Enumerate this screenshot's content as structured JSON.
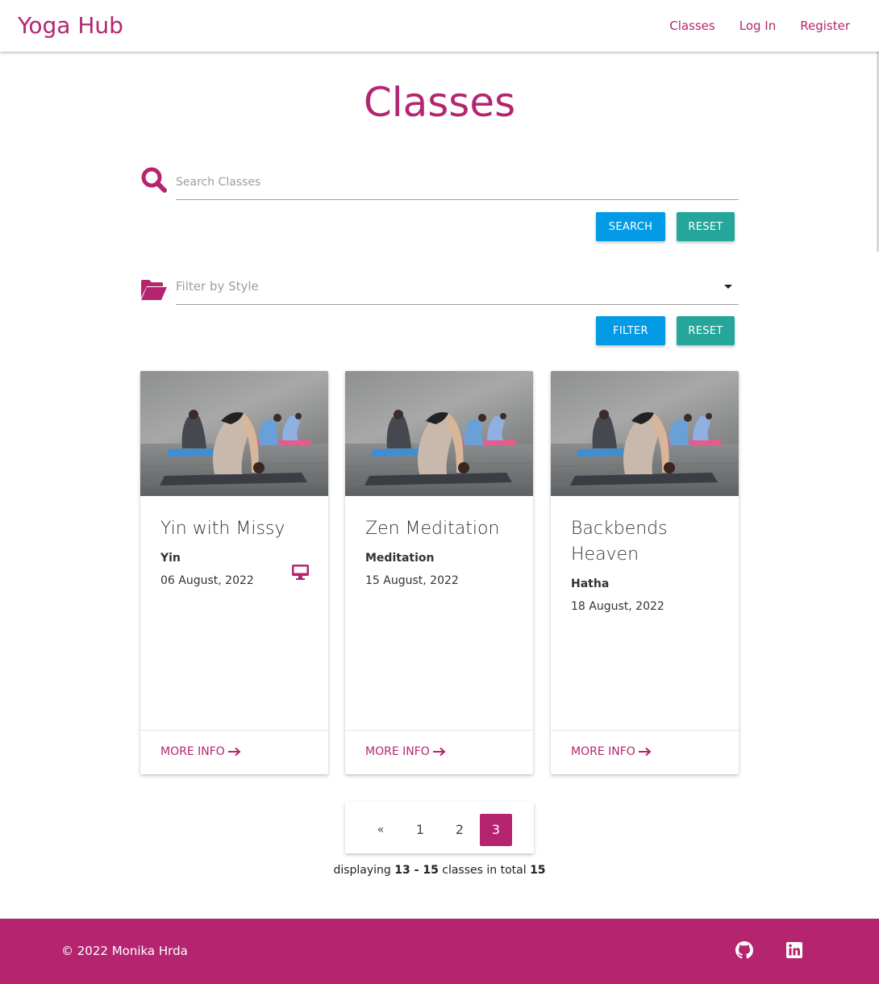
{
  "nav": {
    "brand": "Yoga Hub",
    "links": [
      "Classes",
      "Log In",
      "Register"
    ]
  },
  "page": {
    "title": "Classes"
  },
  "search": {
    "placeholder": "Search Classes",
    "search_label": "SEARCH",
    "reset_label": "RESET",
    "icon": "search-icon"
  },
  "filter": {
    "placeholder": "Filter by Style",
    "filter_label": "FILTER",
    "reset_label": "RESET",
    "icon": "folder-open-icon"
  },
  "classes": [
    {
      "title": "Yin with Missy",
      "style": "Yin",
      "date": "06 August, 2022",
      "online": true,
      "action": "MORE INFO"
    },
    {
      "title": "Zen Meditation",
      "style": "Meditation",
      "date": "15 August, 2022",
      "online": false,
      "action": "MORE INFO"
    },
    {
      "title": "Backbends Heaven",
      "style": "Hatha",
      "date": "18 August, 2022",
      "online": false,
      "action": "MORE INFO"
    }
  ],
  "pagination": {
    "prev": "«",
    "pages": [
      "1",
      "2",
      "3"
    ],
    "active_page": "3",
    "summary": {
      "prefix": "displaying",
      "range": "13 - 15",
      "middle": "classes in total",
      "total": "15"
    }
  },
  "footer": {
    "copyright": "© 2022 Monika Hrda",
    "icons": [
      "github-icon",
      "linkedin-icon"
    ]
  },
  "colors": {
    "brand": "#b5256f",
    "primary_button": "#039be5",
    "secondary_button": "#26a69a"
  }
}
